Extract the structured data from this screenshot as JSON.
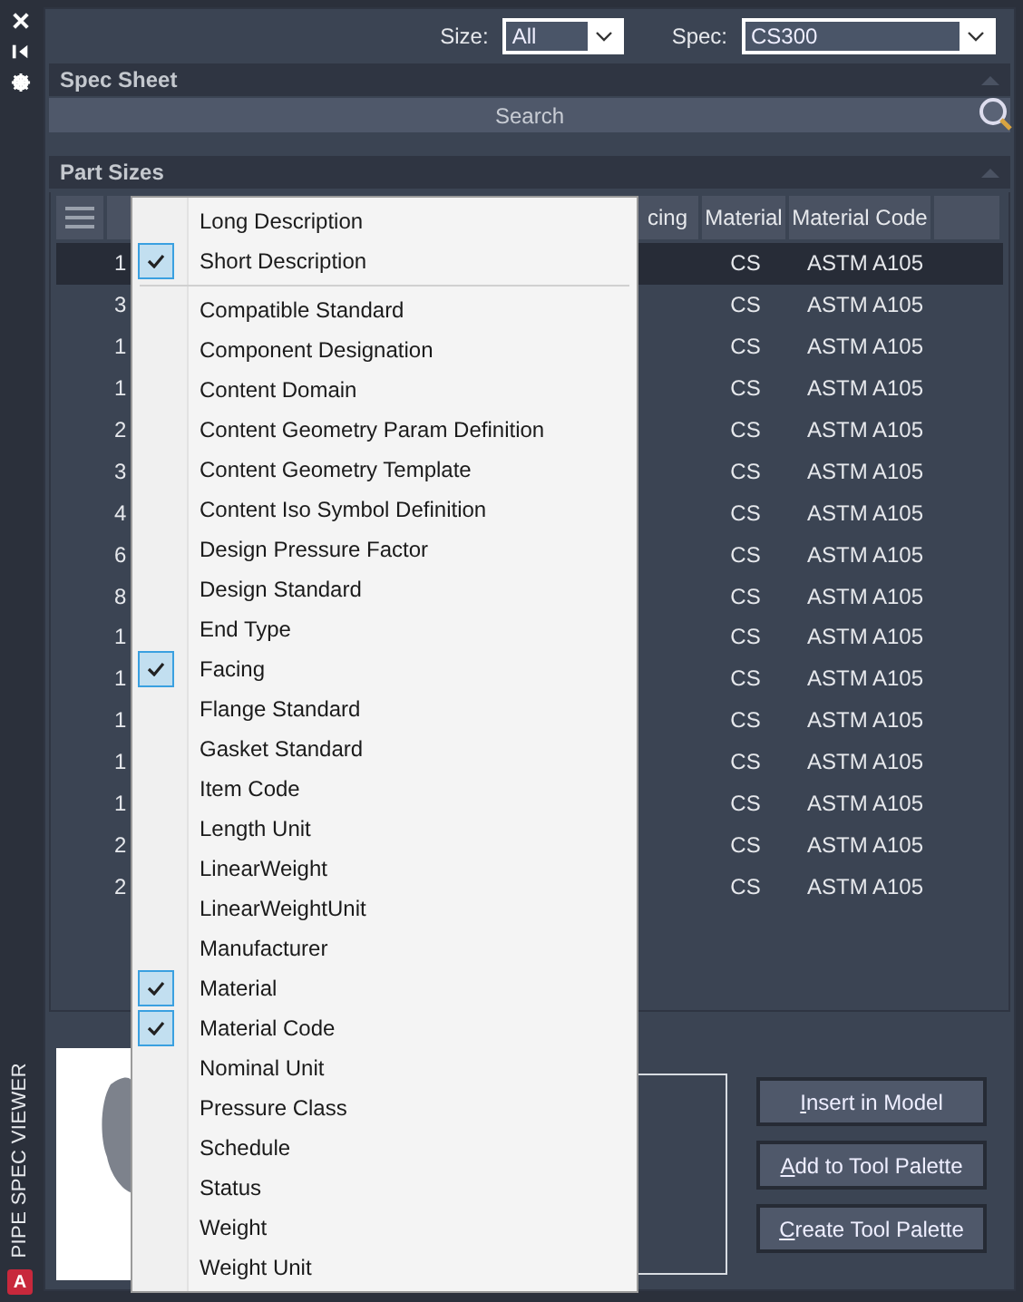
{
  "side_strip": {
    "title": "PIPE SPEC VIEWER",
    "app_logo": "A"
  },
  "filters": {
    "size_label": "Size:",
    "size_value": "All",
    "spec_label": "Spec:",
    "spec_value": "CS300"
  },
  "spec_sheet": {
    "title": "Spec Sheet",
    "search_placeholder": "Search"
  },
  "part_sizes": {
    "title": "Part Sizes",
    "columns": [
      "cing",
      "Material",
      "Material Code"
    ],
    "rows": [
      {
        "column_1": "1",
        "material": "CS",
        "material_code": "ASTM A105",
        "selected": true
      },
      {
        "column_1": "3",
        "material": "CS",
        "material_code": "ASTM A105",
        "selected": false
      },
      {
        "column_1": "1",
        "material": "CS",
        "material_code": "ASTM A105",
        "selected": false
      },
      {
        "column_1": "1",
        "material": "CS",
        "material_code": "ASTM A105",
        "selected": false
      },
      {
        "column_1": "2",
        "material": "CS",
        "material_code": "ASTM A105",
        "selected": false
      },
      {
        "column_1": "3",
        "material": "CS",
        "material_code": "ASTM A105",
        "selected": false
      },
      {
        "column_1": "4",
        "material": "CS",
        "material_code": "ASTM A105",
        "selected": false
      },
      {
        "column_1": "6",
        "material": "CS",
        "material_code": "ASTM A105",
        "selected": false
      },
      {
        "column_1": "8",
        "material": "CS",
        "material_code": "ASTM A105",
        "selected": false
      },
      {
        "column_1": "1",
        "material": "CS",
        "material_code": "ASTM A105",
        "selected": false
      },
      {
        "column_1": "1",
        "material": "CS",
        "material_code": "ASTM A105",
        "selected": false
      },
      {
        "column_1": "1",
        "material": "CS",
        "material_code": "ASTM A105",
        "selected": false
      },
      {
        "column_1": "1",
        "material": "CS",
        "material_code": "ASTM A105",
        "selected": false
      },
      {
        "column_1": "1",
        "material": "CS",
        "material_code": "ASTM A105",
        "selected": false
      },
      {
        "column_1": "2",
        "material": "CS",
        "material_code": "ASTM A105",
        "selected": false
      },
      {
        "column_1": "2",
        "material": "CS",
        "material_code": "ASTM A105",
        "selected": false
      }
    ]
  },
  "column_menu": [
    {
      "label": "Long Description",
      "checked": false
    },
    {
      "label": "Short Description",
      "checked": true,
      "separator_after": true
    },
    {
      "label": "Compatible Standard",
      "checked": false
    },
    {
      "label": "Component Designation",
      "checked": false
    },
    {
      "label": "Content Domain",
      "checked": false
    },
    {
      "label": "Content Geometry Param Definition",
      "checked": false
    },
    {
      "label": "Content Geometry Template",
      "checked": false
    },
    {
      "label": "Content Iso Symbol Definition",
      "checked": false
    },
    {
      "label": "Design Pressure Factor",
      "checked": false
    },
    {
      "label": "Design Standard",
      "checked": false
    },
    {
      "label": "End Type",
      "checked": false
    },
    {
      "label": "Facing",
      "checked": true
    },
    {
      "label": "Flange Standard",
      "checked": false
    },
    {
      "label": "Gasket Standard",
      "checked": false
    },
    {
      "label": "Item Code",
      "checked": false
    },
    {
      "label": "Length Unit",
      "checked": false
    },
    {
      "label": "LinearWeight",
      "checked": false
    },
    {
      "label": "LinearWeightUnit",
      "checked": false
    },
    {
      "label": "Manufacturer",
      "checked": false
    },
    {
      "label": "Material",
      "checked": true
    },
    {
      "label": "Material Code",
      "checked": true
    },
    {
      "label": "Nominal Unit",
      "checked": false
    },
    {
      "label": "Pressure Class",
      "checked": false
    },
    {
      "label": "Schedule",
      "checked": false
    },
    {
      "label": "Status",
      "checked": false
    },
    {
      "label": "Weight",
      "checked": false
    },
    {
      "label": "Weight Unit",
      "checked": false
    }
  ],
  "buttons": [
    "Insert in Model",
    "Add to Tool Palette",
    "Create Tool Palette"
  ]
}
